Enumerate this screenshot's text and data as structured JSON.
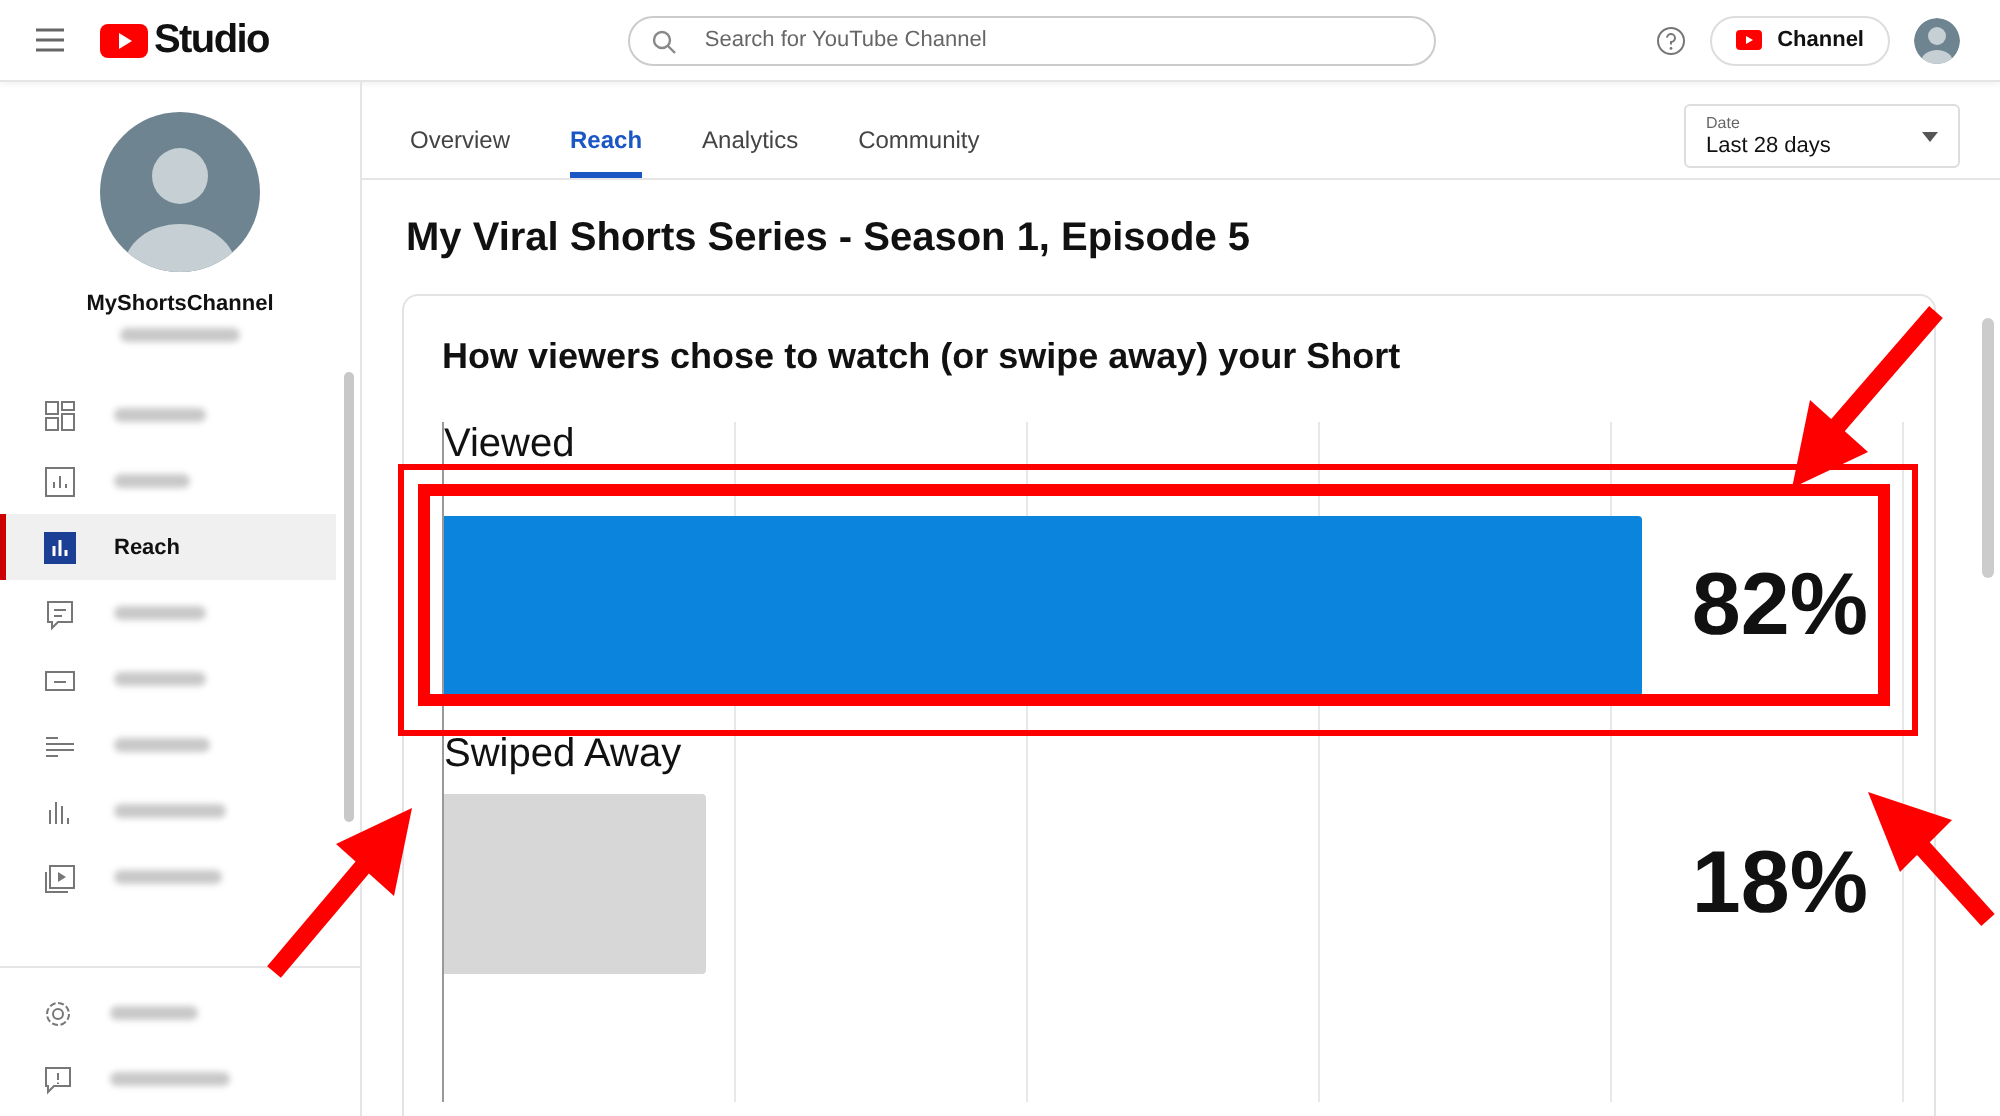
{
  "header": {
    "logo_text": "Studio",
    "search": {
      "placeholder": "Search for YouTube Channel"
    },
    "channel_button": "Channel"
  },
  "sidebar": {
    "channel_name": "MyShortsChannel",
    "subscribers_blurred": true,
    "items": [
      {
        "blurred": true,
        "selected": false
      },
      {
        "blurred": true,
        "selected": false
      },
      {
        "label": "Reach",
        "blurred": false,
        "selected": true
      },
      {
        "blurred": true,
        "selected": false
      },
      {
        "blurred": true,
        "selected": false
      },
      {
        "blurred": true,
        "selected": false
      },
      {
        "blurred": true,
        "selected": false
      },
      {
        "blurred": true,
        "selected": false
      }
    ],
    "footer_items": [
      {
        "blurred": true
      },
      {
        "blurred": true
      }
    ]
  },
  "tabs": [
    {
      "label": "Overview",
      "selected": false
    },
    {
      "label": "Reach",
      "selected": true
    },
    {
      "label": "Analytics",
      "selected": false
    },
    {
      "label": "Community",
      "selected": false
    }
  ],
  "date_picker": {
    "label": "Date",
    "value": "Last 28 days"
  },
  "title": "My Viral Shorts Series - Season 1, Episode 5",
  "card": {
    "title": "How viewers chose to watch (or swipe away) your Short",
    "rows": [
      {
        "label": "Viewed",
        "level": 0.82,
        "reading": "82%",
        "kind": "primary",
        "highlighted": true
      },
      {
        "label": "Swiped Away",
        "level": 0.18,
        "reading": "18%",
        "kind": "secondary",
        "highlighted": false
      }
    ]
  }
}
